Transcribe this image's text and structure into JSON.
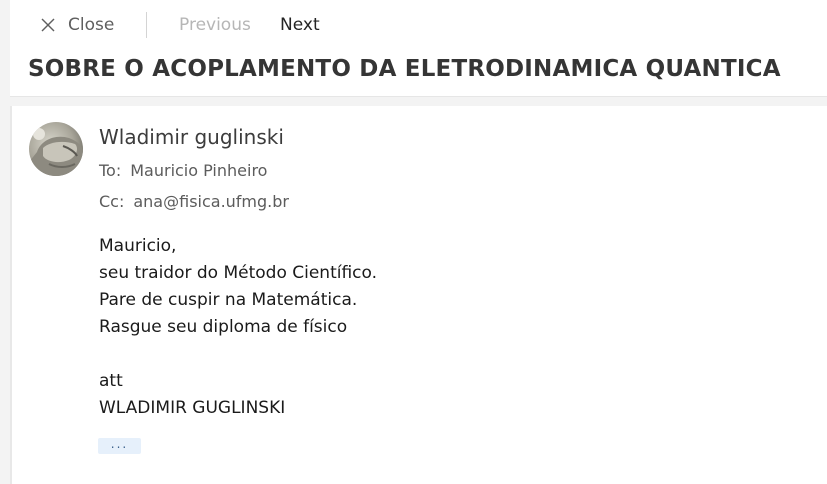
{
  "toolbar": {
    "close_label": "Close",
    "previous_label": "Previous",
    "next_label": "Next"
  },
  "subject": "SOBRE O ACOPLAMENTO DA ELETRODINAMICA QUANTICA",
  "message": {
    "sender": "Wladimir guglinski",
    "to_label": "To:",
    "to_value": "Mauricio Pinheiro",
    "cc_label": "Cc:",
    "cc_value": "ana@fisica.ufmg.br",
    "body_lines": [
      "Mauricio,",
      "seu traidor do Método Científico.",
      "Pare de cuspir na Matemática.",
      "Rasgue seu diploma de físico",
      "",
      "att",
      "WLADIMIR GUGLINSKI"
    ],
    "more_label": "...",
    "avatar_icon": "sender-avatar-photo"
  }
}
